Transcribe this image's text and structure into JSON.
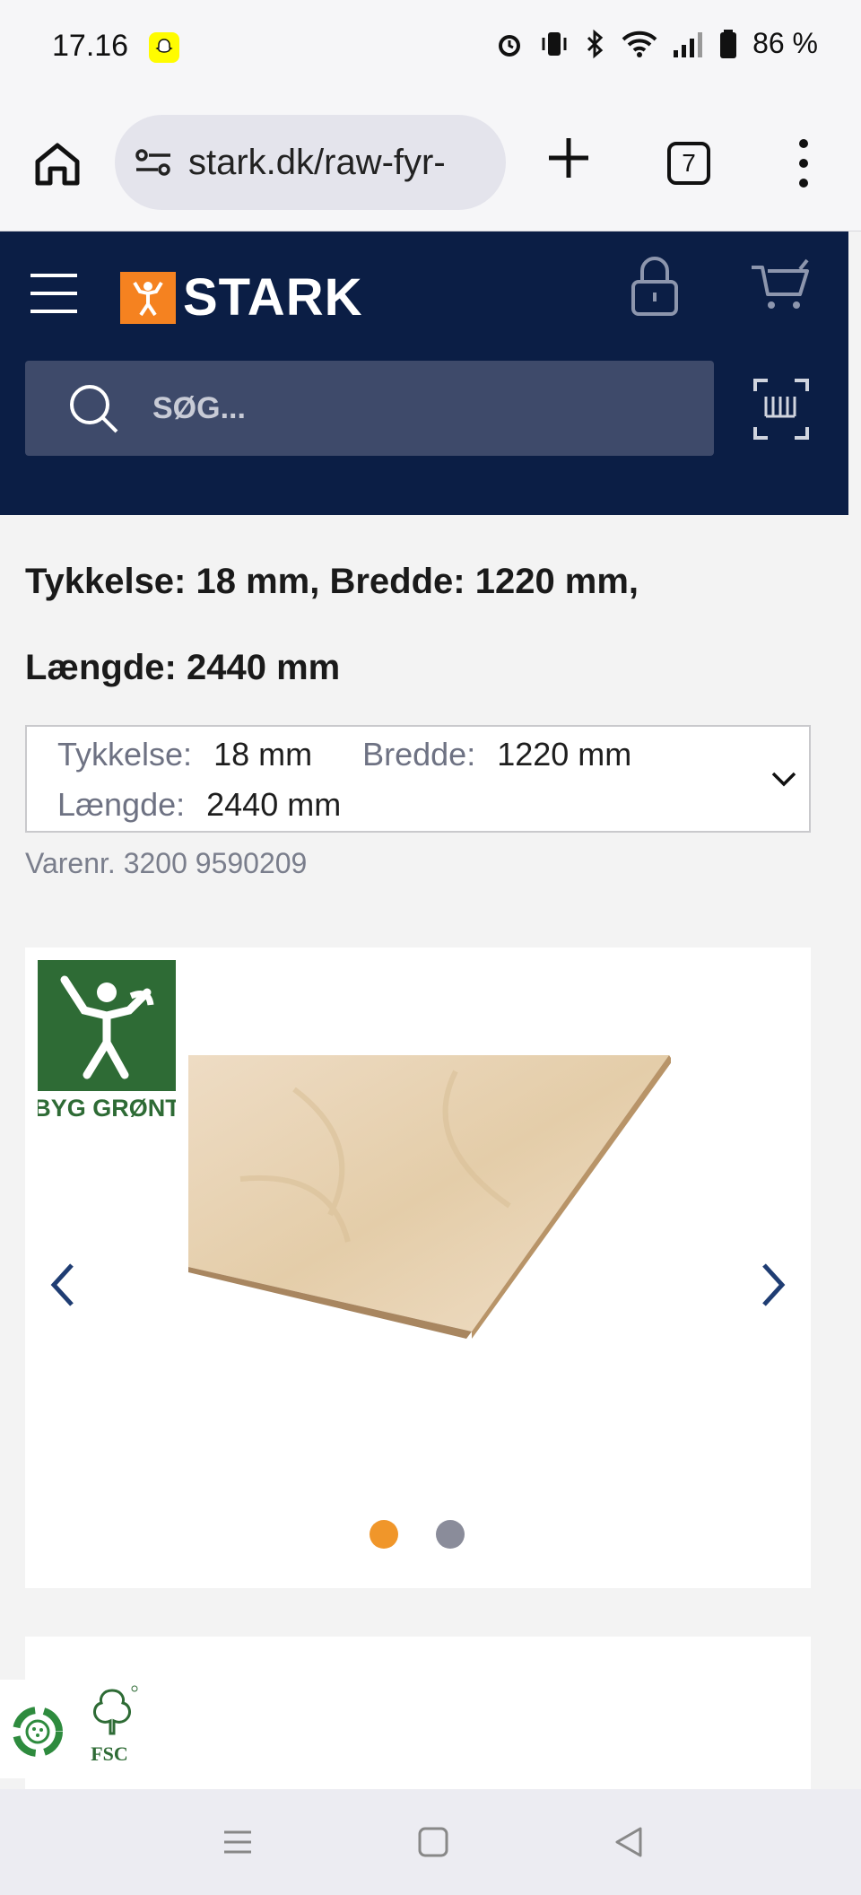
{
  "status": {
    "time": "17.16",
    "battery": "86 %"
  },
  "browser": {
    "url": "stark.dk/raw-fyr-",
    "tab_count": "7"
  },
  "header": {
    "brand": "STARK",
    "search_placeholder": "SØG..."
  },
  "product": {
    "title_line1": "Tykkelse: 18 mm, Bredde: 1220 mm,",
    "title_line2": "Længde: 2440 mm",
    "variant": {
      "thickness_label": "Tykkelse:",
      "thickness_value": "18 mm",
      "width_label": "Bredde:",
      "width_value": "1220 mm",
      "length_label": "Længde:",
      "length_value": "2440 mm"
    },
    "item_number": "Varenr. 3200 9590209"
  },
  "gallery": {
    "badge_text": "BYG GRØNT",
    "active_dot": 1,
    "dot_count": 2
  },
  "certifications": {
    "fsc_label": "FSC"
  },
  "colors": {
    "navy": "#0b1e45",
    "orange": "#f58220",
    "green": "#2e6b35"
  }
}
